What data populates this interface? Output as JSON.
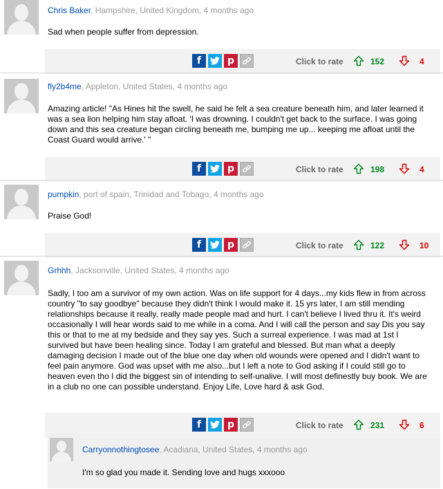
{
  "comments": [
    {
      "author": "Chris Baker",
      "location": ", Hampshire, United Kingdom, 4 months ago",
      "text": "Sad when people suffer from depression.",
      "rate_label": "Click to rate",
      "up": "152",
      "down": "4"
    },
    {
      "author": "fly2b4me",
      "location": ", Appleton, United States, 4 months ago",
      "text": "Amazing article! \"As Hines hit the swell, he said he felt a sea creature beneath him, and later learned it was a sea lion helping him stay afloat. 'I was drowning. I couldn't get back to the surface. I was going down and this sea creature began circling beneath me, bumping me up... keeping me afloat until the Coast Guard would arrive.' \"",
      "rate_label": "Click to rate",
      "up": "198",
      "down": "4"
    },
    {
      "author": "pumpkin",
      "location": ", port of spain, Trinidad and Tobago, 4 months ago",
      "text": "Praise God!",
      "rate_label": "Click to rate",
      "up": "122",
      "down": "10"
    },
    {
      "author": "Grhhh",
      "location": ", Jacksonville, United States, 4 months ago",
      "text": "Sadly, I too am a survivor of my own action. Was on life support for 4 days...my kids flew in from across country \"to say goodbye\" because they didn't think I would make it. 15 yrs later, I am still mending relationships because it really, really made people mad and hurt. I can't believe I lived thru it. It's weird occasionally I will hear words said to me while in a coma. And I will call the person and say Dis you say this or that to me at my bedside and they say yes. Such a surreal experience. I was mad at 1st I survived but have been healing since. Today I am grateful and blessed. But man what a deeply damaging decision I made out of the blue one day when old wounds were opened and I didn't want to feel pain anymore. God was upset with me also...but I left a note to God asking if I could still go to heaven even tho I did the biggest sin of intending to self-unalive. I will most definestly buy book. We are in a club no one can possible understand. Enjoy Life, Love hard & ask God.",
      "rate_label": "Click to rate",
      "up": "231",
      "down": "6"
    }
  ],
  "reply": {
    "author": "Carryonnothingtosee",
    "location": ", Acadiana, United States, 4 months ago",
    "text": "I'm so glad you made it. Sending love and hugs xxxooo"
  },
  "icons": {
    "facebook": "f",
    "twitter": "t",
    "pinterest": "p",
    "link": "link",
    "up": "arrow-up",
    "down": "arrow-down"
  },
  "colors": {
    "author": "#004db3",
    "up": "#00881e",
    "down": "#e00000"
  }
}
